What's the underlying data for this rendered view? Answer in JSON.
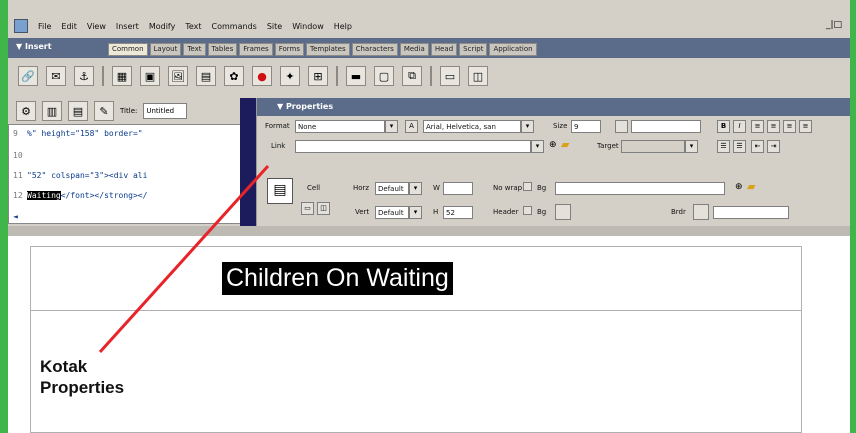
{
  "menubar": {
    "items": [
      "File",
      "Edit",
      "View",
      "Insert",
      "Modify",
      "Text",
      "Commands",
      "Site",
      "Window",
      "Help"
    ],
    "window_controls": "_|□"
  },
  "insert_bar": {
    "label": "▼ Insert",
    "tabs": [
      "Common",
      "Layout",
      "Text",
      "Tables",
      "Frames",
      "Forms",
      "Templates",
      "Characters",
      "Media",
      "Head",
      "Script",
      "Application"
    ],
    "active_tab": "Common"
  },
  "document_toolbar": {
    "title_label": "Title:",
    "title_value": "Untitled"
  },
  "code_view": {
    "lines": [
      {
        "num": "9",
        "text": "%\" height=\"158\" border=\""
      },
      {
        "num": "10",
        "text": ""
      },
      {
        "num": "11",
        "text": "\"52\" colspan=\"3\"><div ali"
      },
      {
        "num": "12",
        "text_highlight": "Waiting",
        "text_rest": "</font></strong></"
      }
    ]
  },
  "properties": {
    "header": "▼ Properties",
    "format_label": "Format",
    "format_value": "None",
    "font_value": "Arial, Helvetica, san",
    "size_label": "Size",
    "size_value": "9",
    "link_label": "Link",
    "link_value": "",
    "target_label": "Target",
    "cell_label": "Cell",
    "horz_label": "Horz",
    "horz_value": "Default",
    "vert_label": "Vert",
    "vert_value": "Default",
    "w_label": "W",
    "h_label": "H",
    "h_value": "52",
    "nowrap_label": "No wrap",
    "header_label": "Header",
    "bg_label": "Bg",
    "brdr_label": "Brdr"
  },
  "page": {
    "heading": "Children On Waiting"
  },
  "callout": {
    "line1": "Kotak",
    "line2": "Properties",
    "line_color": "#e8232a"
  },
  "colors": {
    "border_green": "#3fb54a",
    "panel_header": "#5b6b8a"
  }
}
